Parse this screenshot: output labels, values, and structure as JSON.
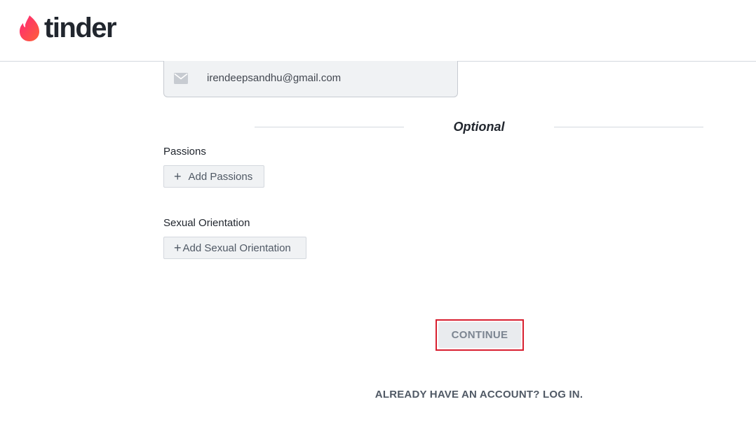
{
  "header": {
    "logo_text": "tinder",
    "logo_icon": "flame-icon",
    "brand_color": "#fd5564"
  },
  "email": {
    "icon": "mail-icon",
    "value": "irendeepsandhu@gmail.com"
  },
  "optional": {
    "label": "Optional"
  },
  "passions": {
    "label": "Passions",
    "button_label": "Add Passions",
    "button_icon": "plus-icon"
  },
  "orientation": {
    "label": "Sexual Orientation",
    "button_label": "Add Sexual Orientation",
    "button_icon": "plus-icon"
  },
  "continue": {
    "label": "CONTINUE",
    "highlight_color": "#d81f2f"
  },
  "login": {
    "label": "ALREADY HAVE AN ACCOUNT? LOG IN."
  }
}
